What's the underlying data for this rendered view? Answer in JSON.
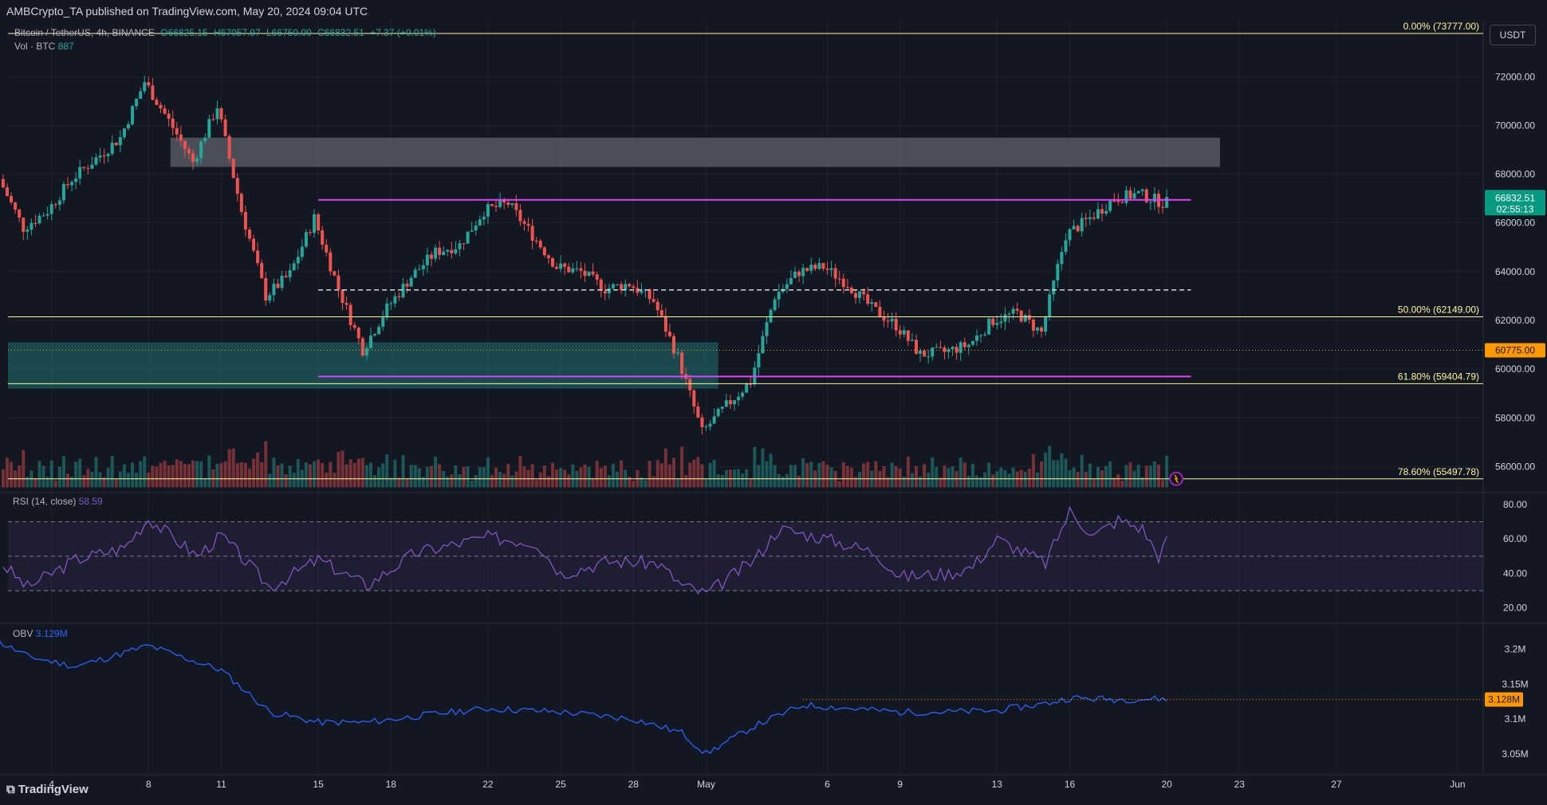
{
  "header": {
    "published": "AMBCrypto_TA published on TradingView.com, May 20, 2024 09:04 UTC",
    "symbol": "Bitcoin / TetherUS, 4h, BINANCE",
    "open": "O66825.15",
    "high": "H67057.97",
    "low": "L66750.00",
    "close": "C66832.51",
    "change": "+7.37 (+0.01%)",
    "volume_label": "Vol · BTC",
    "volume_value": "887",
    "currency": "USDT"
  },
  "footer": {
    "logo": "TradingView"
  },
  "colors": {
    "up": "#26a69a",
    "down": "#ef5350",
    "fib": "#fff59d",
    "range": "#e040fb",
    "rsi": "#7e57c2",
    "obv": "#2962ff",
    "zone_teal": "#26a69a"
  },
  "chart_data": [
    {
      "type": "candlestick",
      "title": "Bitcoin / TetherUS, 4h, BINANCE",
      "timeframe": "4h",
      "x_ticks": [
        "4",
        "8",
        "11",
        "15",
        "18",
        "22",
        "25",
        "28",
        "May",
        "6",
        "9",
        "13",
        "16",
        "20",
        "23",
        "27",
        "Jun"
      ],
      "y_ticks": [
        "72000.00",
        "70000.00",
        "68000.00",
        "66000.00",
        "64000.00",
        "62000.00",
        "60000.00",
        "58000.00",
        "56000.00"
      ],
      "ylim": [
        55000,
        74300
      ],
      "price_path": [
        [
          "Apr 2",
          67800
        ],
        [
          "Apr 3",
          65800
        ],
        [
          "Apr 4",
          66500
        ],
        [
          "Apr 5",
          67800
        ],
        [
          "Apr 7",
          69500
        ],
        [
          "Apr 8",
          71800
        ],
        [
          "Apr 9",
          70200
        ],
        [
          "Apr 10",
          68500
        ],
        [
          "Apr 11",
          70800
        ],
        [
          "Apr 12",
          66500
        ],
        [
          "Apr 13",
          63000
        ],
        [
          "Apr 14",
          63900
        ],
        [
          "Apr 15",
          66200
        ],
        [
          "Apr 16",
          63300
        ],
        [
          "Apr 17",
          60800
        ],
        [
          "Apr 18",
          62500
        ],
        [
          "Apr 19",
          63800
        ],
        [
          "Apr 20",
          64800
        ],
        [
          "Apr 21",
          65100
        ],
        [
          "Apr 22",
          66500
        ],
        [
          "Apr 23",
          66800
        ],
        [
          "Apr 24",
          65500
        ],
        [
          "Apr 25",
          64200
        ],
        [
          "Apr 26",
          64000
        ],
        [
          "Apr 27",
          63300
        ],
        [
          "Apr 28",
          63500
        ],
        [
          "Apr 29",
          62800
        ],
        [
          "Apr 30",
          60500
        ],
        [
          "May 1",
          57400
        ],
        [
          "May 2",
          58500
        ],
        [
          "May 3",
          59500
        ],
        [
          "May 4",
          63000
        ],
        [
          "May 5",
          64000
        ],
        [
          "May 6",
          64200
        ],
        [
          "May 7",
          63500
        ],
        [
          "May 8",
          62500
        ],
        [
          "May 9",
          61800
        ],
        [
          "May 10",
          60600
        ],
        [
          "May 11",
          60700
        ],
        [
          "May 12",
          61000
        ],
        [
          "May 13",
          62000
        ],
        [
          "May 14",
          62300
        ],
        [
          "May 15",
          61500
        ],
        [
          "May 16",
          65500
        ],
        [
          "May 17",
          66200
        ],
        [
          "May 18",
          67000
        ],
        [
          "May 19",
          67200
        ],
        [
          "May 20",
          66832
        ]
      ],
      "last_price": "66832.51",
      "countdown": "02:55:13",
      "level_label": "60775.00",
      "fib_levels": [
        {
          "label": "0.00% (73777.00)",
          "value": 73777
        },
        {
          "label": "50.00% (62149.00)",
          "value": 62149
        },
        {
          "label": "61.80% (59404.79)",
          "value": 59404.79
        },
        {
          "label": "78.60% (55497.78)",
          "value": 55497.78
        }
      ],
      "range_high": 66950,
      "range_low": 59700,
      "range_mid": 63250,
      "supply_zone": [
        68300,
        69500
      ],
      "demand_zone": [
        59200,
        61100
      ],
      "horizontal_level": 60775
    },
    {
      "type": "line",
      "name": "RSI (14, close)",
      "last_value": "58.59",
      "y_ticks": [
        "80.00",
        "60.00",
        "40.00",
        "20.00"
      ],
      "ylim": [
        20,
        80
      ],
      "bands": [
        70,
        50,
        30
      ],
      "path": [
        [
          "Apr 2",
          45
        ],
        [
          "Apr 3",
          32
        ],
        [
          "Apr 5",
          48
        ],
        [
          "Apr 7",
          55
        ],
        [
          "Apr 8",
          72
        ],
        [
          "Apr 10",
          50
        ],
        [
          "Apr 11",
          62
        ],
        [
          "Apr 13",
          32
        ],
        [
          "Apr 15",
          48
        ],
        [
          "Apr 17",
          33
        ],
        [
          "Apr 19",
          52
        ],
        [
          "Apr 22",
          61
        ],
        [
          "Apr 24",
          58
        ],
        [
          "Apr 25",
          40
        ],
        [
          "Apr 27",
          47
        ],
        [
          "Apr 29",
          46
        ],
        [
          "Apr 30",
          33
        ],
        [
          "May 1",
          28
        ],
        [
          "May 3",
          48
        ],
        [
          "May 4",
          66
        ],
        [
          "May 6",
          60
        ],
        [
          "May 8",
          52
        ],
        [
          "May 9",
          38
        ],
        [
          "May 11",
          40
        ],
        [
          "May 12",
          44
        ],
        [
          "May 13",
          60
        ],
        [
          "May 15",
          46
        ],
        [
          "May 16",
          76
        ],
        [
          "May 17",
          62
        ],
        [
          "May 18",
          71
        ],
        [
          "May 19",
          66
        ],
        [
          "May 19 16:00",
          50
        ],
        [
          "May 20",
          58.59
        ]
      ]
    },
    {
      "type": "line",
      "name": "OBV",
      "last_value": "3.129M",
      "price_label": "3.128M",
      "y_ticks": [
        "3.2M",
        "3.15M",
        "3.1M",
        "3.05M"
      ],
      "ylim": [
        3.02,
        3.235
      ],
      "path": [
        [
          "Apr 1",
          3.225
        ],
        [
          "Apr 3",
          3.19
        ],
        [
          "Apr 5",
          3.175
        ],
        [
          "Apr 8",
          3.205
        ],
        [
          "Apr 11",
          3.17
        ],
        [
          "Apr 13",
          3.11
        ],
        [
          "Apr 15",
          3.095
        ],
        [
          "Apr 17",
          3.095
        ],
        [
          "Apr 20",
          3.108
        ],
        [
          "Apr 22",
          3.115
        ],
        [
          "Apr 25",
          3.11
        ],
        [
          "Apr 28",
          3.1
        ],
        [
          "Apr 30",
          3.08
        ],
        [
          "May 1",
          3.05
        ],
        [
          "May 3",
          3.09
        ],
        [
          "May 5",
          3.12
        ],
        [
          "May 7",
          3.115
        ],
        [
          "May 9",
          3.11
        ],
        [
          "May 11",
          3.11
        ],
        [
          "May 13",
          3.112
        ],
        [
          "May 15",
          3.122
        ],
        [
          "May 16",
          3.13
        ],
        [
          "May 18",
          3.128
        ],
        [
          "May 20",
          3.129
        ]
      ]
    }
  ]
}
